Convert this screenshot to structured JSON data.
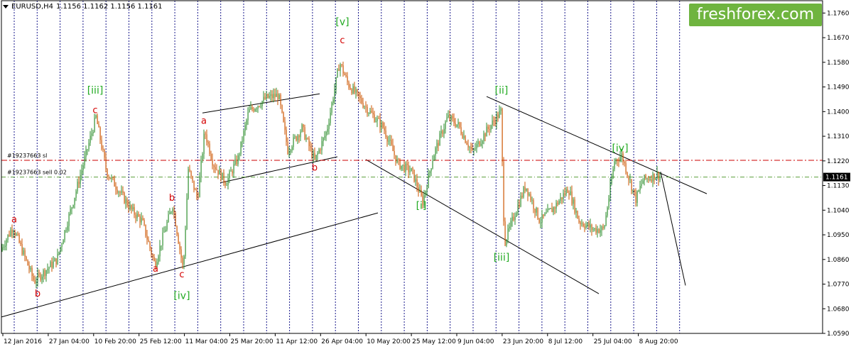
{
  "header": {
    "symbol": "EURUSD,H4",
    "ohlc": "1.1156 1.1162 1.1156 1.1161"
  },
  "brand": {
    "text": "freshforex.com"
  },
  "colors": {
    "bull": "#2f8f2f",
    "bear": "#cc5500",
    "red_label": "#d40000",
    "green_label": "#22aa22",
    "grid": "#1a1a8c",
    "sl_line": "#cc0000",
    "entry_line": "#5a9e3a"
  },
  "chart_data": {
    "type": "candlestick",
    "ylim": [
      1.059,
      1.1805
    ],
    "y_ticks": [
      "1.1760",
      "1.1670",
      "1.1580",
      "1.1490",
      "1.1400",
      "1.1310",
      "1.1220",
      "1.1130",
      "1.1040",
      "1.0950",
      "1.0860",
      "1.0770",
      "1.0680",
      "1.0590"
    ],
    "current_price": "1.1161",
    "x_labels": [
      "12 Jan 2016",
      "27 Jan 04:00",
      "10 Feb 20:00",
      "25 Feb 12:00",
      "11 Mar 04:00",
      "25 Mar 20:00",
      "11 Apr 12:00",
      "26 Apr 04:00",
      "10 May 20:00",
      "25 May 12:00",
      "9 Jun 04:00",
      "23 Jun 20:00",
      "8 Jul 12:00",
      "25 Jul 04:00",
      "8 Aug 20:00"
    ],
    "levels": [
      {
        "label": "#19237663 sl",
        "price": 1.1222,
        "style": "sl"
      },
      {
        "label": "#19237663 sell 0.02",
        "price": 1.1161,
        "style": "entry"
      }
    ],
    "path": [
      [
        0,
        1.089
      ],
      [
        18,
        1.098
      ],
      [
        48,
        1.078
      ],
      [
        80,
        1.086
      ],
      [
        108,
        1.112
      ],
      [
        135,
        1.138
      ],
      [
        150,
        1.118
      ],
      [
        185,
        1.104
      ],
      [
        200,
        1.1
      ],
      [
        218,
        1.084
      ],
      [
        230,
        1.095
      ],
      [
        243,
        1.106
      ],
      [
        258,
        1.082
      ],
      [
        265,
        1.119
      ],
      [
        278,
        1.108
      ],
      [
        288,
        1.133
      ],
      [
        300,
        1.121
      ],
      [
        318,
        1.114
      ],
      [
        335,
        1.123
      ],
      [
        350,
        1.14
      ],
      [
        375,
        1.145
      ],
      [
        392,
        1.146
      ],
      [
        405,
        1.126
      ],
      [
        425,
        1.134
      ],
      [
        443,
        1.122
      ],
      [
        460,
        1.133
      ],
      [
        478,
        1.158
      ],
      [
        490,
        1.15
      ],
      [
        520,
        1.14
      ],
      [
        540,
        1.134
      ],
      [
        560,
        1.121
      ],
      [
        580,
        1.118
      ],
      [
        595,
        1.107
      ],
      [
        610,
        1.124
      ],
      [
        630,
        1.138
      ],
      [
        645,
        1.135
      ],
      [
        665,
        1.125
      ],
      [
        685,
        1.133
      ],
      [
        705,
        1.14
      ],
      [
        710,
        1.092
      ],
      [
        725,
        1.103
      ],
      [
        740,
        1.113
      ],
      [
        760,
        1.1
      ],
      [
        780,
        1.105
      ],
      [
        800,
        1.112
      ],
      [
        815,
        1.1
      ],
      [
        835,
        1.097
      ],
      [
        850,
        1.097
      ],
      [
        865,
        1.122
      ],
      [
        875,
        1.124
      ],
      [
        895,
        1.108
      ],
      [
        905,
        1.115
      ],
      [
        925,
        1.117
      ],
      [
        930,
        1.116
      ]
    ],
    "annotations": [
      {
        "text": "a",
        "kind": "red"
      },
      {
        "text": "b",
        "kind": "red"
      },
      {
        "text": "[iii]",
        "kind": "green"
      },
      {
        "text": "c",
        "kind": "red"
      },
      {
        "text": "a",
        "kind": "red"
      },
      {
        "text": "b",
        "kind": "red"
      },
      {
        "text": "c",
        "kind": "red"
      },
      {
        "text": "[iv]",
        "kind": "green"
      },
      {
        "text": "a",
        "kind": "red"
      },
      {
        "text": "b",
        "kind": "red"
      },
      {
        "text": "[v]",
        "kind": "green"
      },
      {
        "text": "c",
        "kind": "red"
      },
      {
        "text": "[i]",
        "kind": "green"
      },
      {
        "text": "[ii]",
        "kind": "green"
      },
      {
        "text": "[iii]",
        "kind": "green"
      },
      {
        "text": "[iv]",
        "kind": "green"
      }
    ]
  }
}
